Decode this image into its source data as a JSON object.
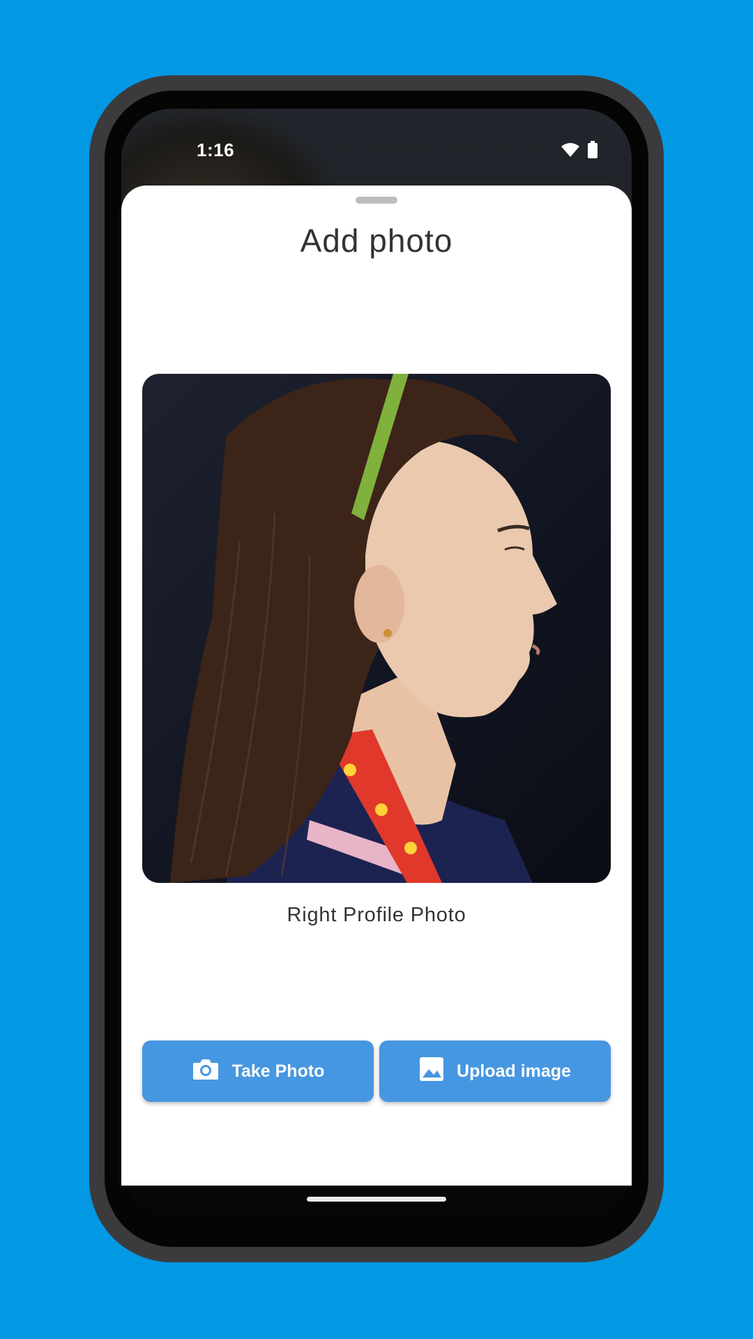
{
  "status_bar": {
    "time": "1:16",
    "wifi_icon": "wifi-icon",
    "battery_icon": "battery-icon"
  },
  "sheet": {
    "title": "Add photo",
    "photo_caption": "Right Profile Photo"
  },
  "actions": {
    "take_photo_label": "Take Photo",
    "take_photo_icon": "camera-icon",
    "upload_label": "Upload image",
    "upload_icon": "image-icon"
  },
  "colors": {
    "background": "#0398e4",
    "button": "#4697e1",
    "sheet": "#ffffff"
  }
}
